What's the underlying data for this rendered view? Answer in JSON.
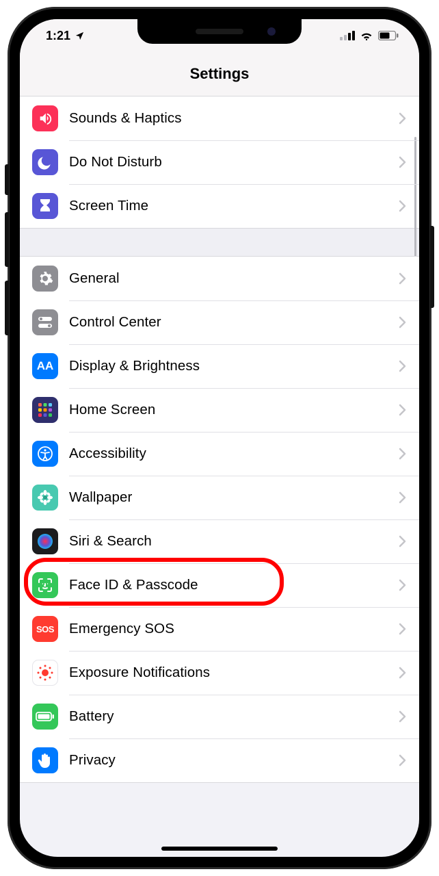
{
  "statusbar": {
    "time": "1:21"
  },
  "header": {
    "title": "Settings"
  },
  "groups": [
    {
      "rows": [
        {
          "id": "sounds",
          "label": "Sounds & Haptics",
          "icon": "volume-icon",
          "bg": "bg-pink"
        },
        {
          "id": "dnd",
          "label": "Do Not Disturb",
          "icon": "moon-icon",
          "bg": "bg-indigo"
        },
        {
          "id": "screentime",
          "label": "Screen Time",
          "icon": "hourglass-icon",
          "bg": "bg-indigo"
        }
      ]
    },
    {
      "rows": [
        {
          "id": "general",
          "label": "General",
          "icon": "gear-icon",
          "bg": "bg-gray"
        },
        {
          "id": "controlcenter",
          "label": "Control Center",
          "icon": "toggles-icon",
          "bg": "bg-gray"
        },
        {
          "id": "display",
          "label": "Display & Brightness",
          "icon": "text-size-icon",
          "bg": "bg-blue"
        },
        {
          "id": "homescreen",
          "label": "Home Screen",
          "icon": "app-grid-icon",
          "bg": "bg-grid"
        },
        {
          "id": "accessibility",
          "label": "Accessibility",
          "icon": "accessibility-icon",
          "bg": "bg-blue"
        },
        {
          "id": "wallpaper",
          "label": "Wallpaper",
          "icon": "flower-icon",
          "bg": "bg-teal"
        },
        {
          "id": "siri",
          "label": "Siri & Search",
          "icon": "siri-icon",
          "bg": "bg-dark"
        },
        {
          "id": "faceid",
          "label": "Face ID & Passcode",
          "icon": "faceid-icon",
          "bg": "bg-green",
          "highlighted": true
        },
        {
          "id": "sos",
          "label": "Emergency SOS",
          "icon": "sos-icon",
          "bg": "bg-red"
        },
        {
          "id": "exposure",
          "label": "Exposure Notifications",
          "icon": "exposure-icon",
          "bg": "bg-white"
        },
        {
          "id": "battery",
          "label": "Battery",
          "icon": "battery-icon",
          "bg": "bg-green"
        },
        {
          "id": "privacy",
          "label": "Privacy",
          "icon": "hand-icon",
          "bg": "bg-blue"
        }
      ]
    }
  ]
}
